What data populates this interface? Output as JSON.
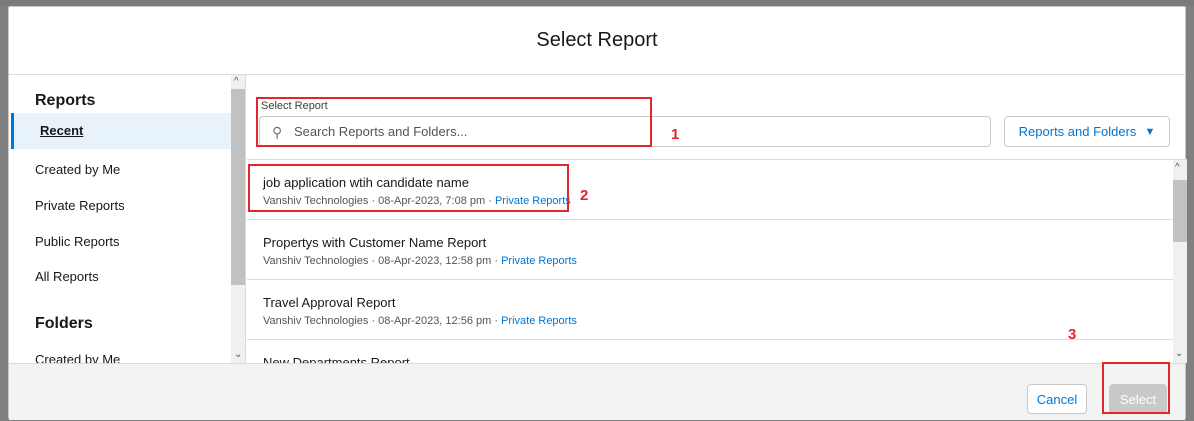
{
  "modal": {
    "title": "Select Report"
  },
  "sidebar": {
    "reports_heading": "Reports",
    "report_items": [
      {
        "label": "Recent",
        "active": true
      },
      {
        "label": "Created by Me"
      },
      {
        "label": "Private Reports"
      },
      {
        "label": "Public Reports"
      },
      {
        "label": "All Reports"
      }
    ],
    "folders_heading": "Folders",
    "folder_items": [
      {
        "label": "Created by Me"
      }
    ]
  },
  "search": {
    "label": "Select Report",
    "placeholder": "Search Reports and Folders...",
    "value": "",
    "icon": "search-icon"
  },
  "filter": {
    "label": "Reports and Folders",
    "icon": "caret-down-icon"
  },
  "results": [
    {
      "title": "job application wtih candidate name",
      "meta": "Vanshiv Technologies · 08-Apr-2023, 7:08 pm · ",
      "link": "Private Reports"
    },
    {
      "title": "Propertys with Customer Name Report",
      "meta": "Vanshiv Technologies · 08-Apr-2023, 12:58 pm · ",
      "link": "Private Reports"
    },
    {
      "title": "Travel Approval Report",
      "meta": "Vanshiv Technologies · 08-Apr-2023, 12:56 pm · ",
      "link": "Private Reports"
    },
    {
      "title": "New Departments Report",
      "meta": "",
      "link": ""
    }
  ],
  "footer": {
    "cancel_label": "Cancel",
    "select_label": "Select"
  },
  "annotations": {
    "one": "1",
    "two": "2",
    "three": "3"
  },
  "colors": {
    "accent": "#0176d3",
    "annotation": "#e0262e",
    "active_bg": "#e8f2fb"
  }
}
